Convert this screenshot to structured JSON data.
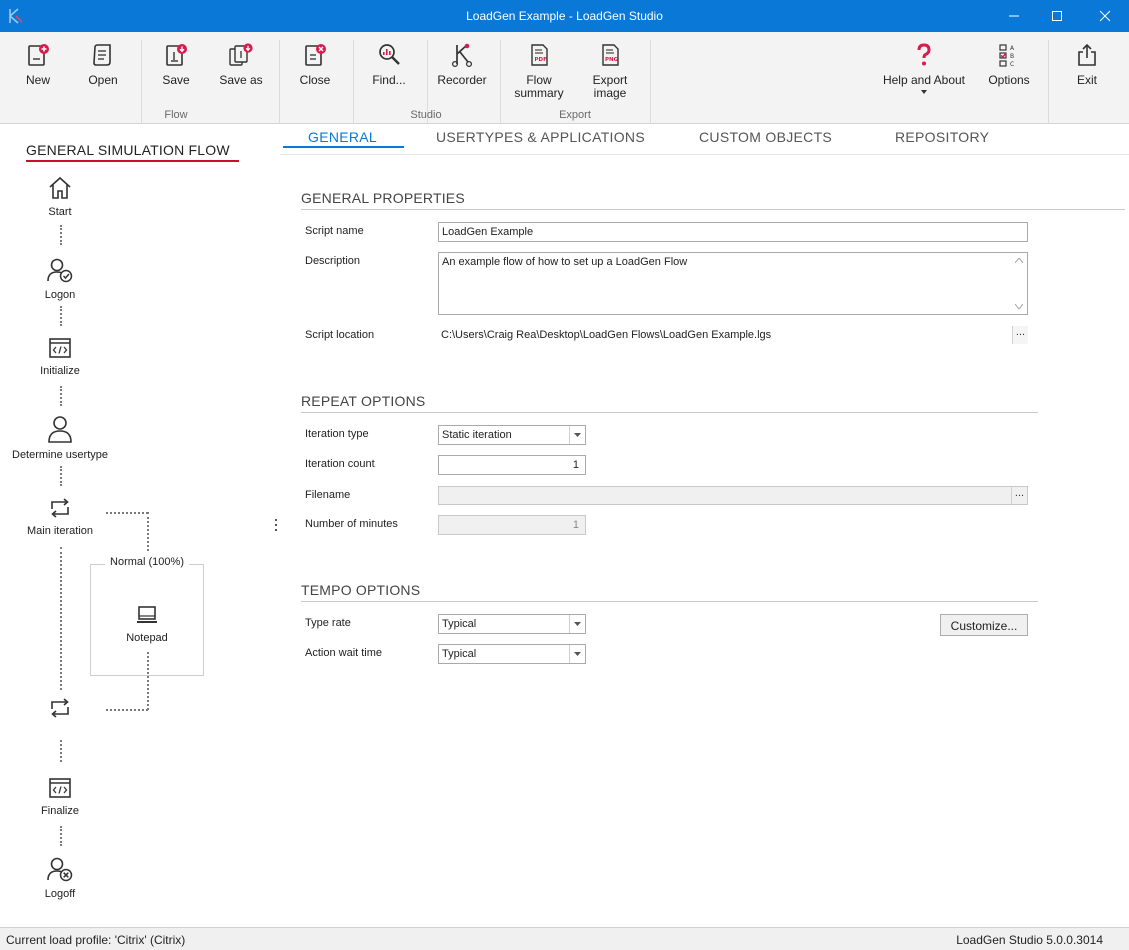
{
  "window": {
    "title": "LoadGen Example - LoadGen Studio"
  },
  "ribbon": {
    "buttons": {
      "new": "New",
      "open": "Open",
      "save": "Save",
      "save_as": "Save as",
      "close": "Close",
      "find": "Find...",
      "recorder": "Recorder",
      "flow_summary_1": "Flow",
      "flow_summary_2": "summary",
      "export_image_1": "Export",
      "export_image_2": "image",
      "help": "Help and About",
      "options": "Options",
      "exit": "Exit"
    },
    "groups": {
      "flow": "Flow",
      "studio": "Studio",
      "export": "Export"
    }
  },
  "flow": {
    "title": "GENERAL SIMULATION FLOW",
    "nodes": {
      "start": "Start",
      "logon": "Logon",
      "initialize": "Initialize",
      "determine": "Determine usertype",
      "main_iteration": "Main iteration",
      "normal": "Normal (100%)",
      "notepad": "Notepad",
      "finalize": "Finalize",
      "logoff": "Logoff"
    }
  },
  "tabs": {
    "general": "GENERAL",
    "usertypes": "USERTYPES & APPLICATIONS",
    "custom_objects": "CUSTOM OBJECTS",
    "repository": "REPOSITORY"
  },
  "general_properties": {
    "title": "GENERAL PROPERTIES",
    "script_name_label": "Script name",
    "script_name_value": "LoadGen Example",
    "description_label": "Description",
    "description_value": "An example flow of how to set up a LoadGen Flow",
    "script_location_label": "Script location",
    "script_location_value": "C:\\Users\\Craig Rea\\Desktop\\LoadGen Flows\\LoadGen Example.lgs",
    "browse_label": "..."
  },
  "repeat_options": {
    "title": "REPEAT OPTIONS",
    "iteration_type_label": "Iteration type",
    "iteration_type_value": "Static iteration",
    "iteration_count_label": "Iteration count",
    "iteration_count_value": "1",
    "filename_label": "Filename",
    "filename_value": "",
    "browse_label": "...",
    "minutes_label": "Number of minutes",
    "minutes_value": "1"
  },
  "tempo_options": {
    "title": "TEMPO OPTIONS",
    "type_rate_label": "Type rate",
    "type_rate_value": "Typical",
    "action_wait_label": "Action wait time",
    "action_wait_value": "Typical",
    "customize_label": "Customize..."
  },
  "status": {
    "left": "Current load profile: 'Citrix' (Citrix)",
    "right": "LoadGen Studio 5.0.0.3014"
  },
  "colors": {
    "titlebar": "#0a78d7",
    "accent_red": "#c8102e",
    "tab_active": "#0a78d7"
  }
}
